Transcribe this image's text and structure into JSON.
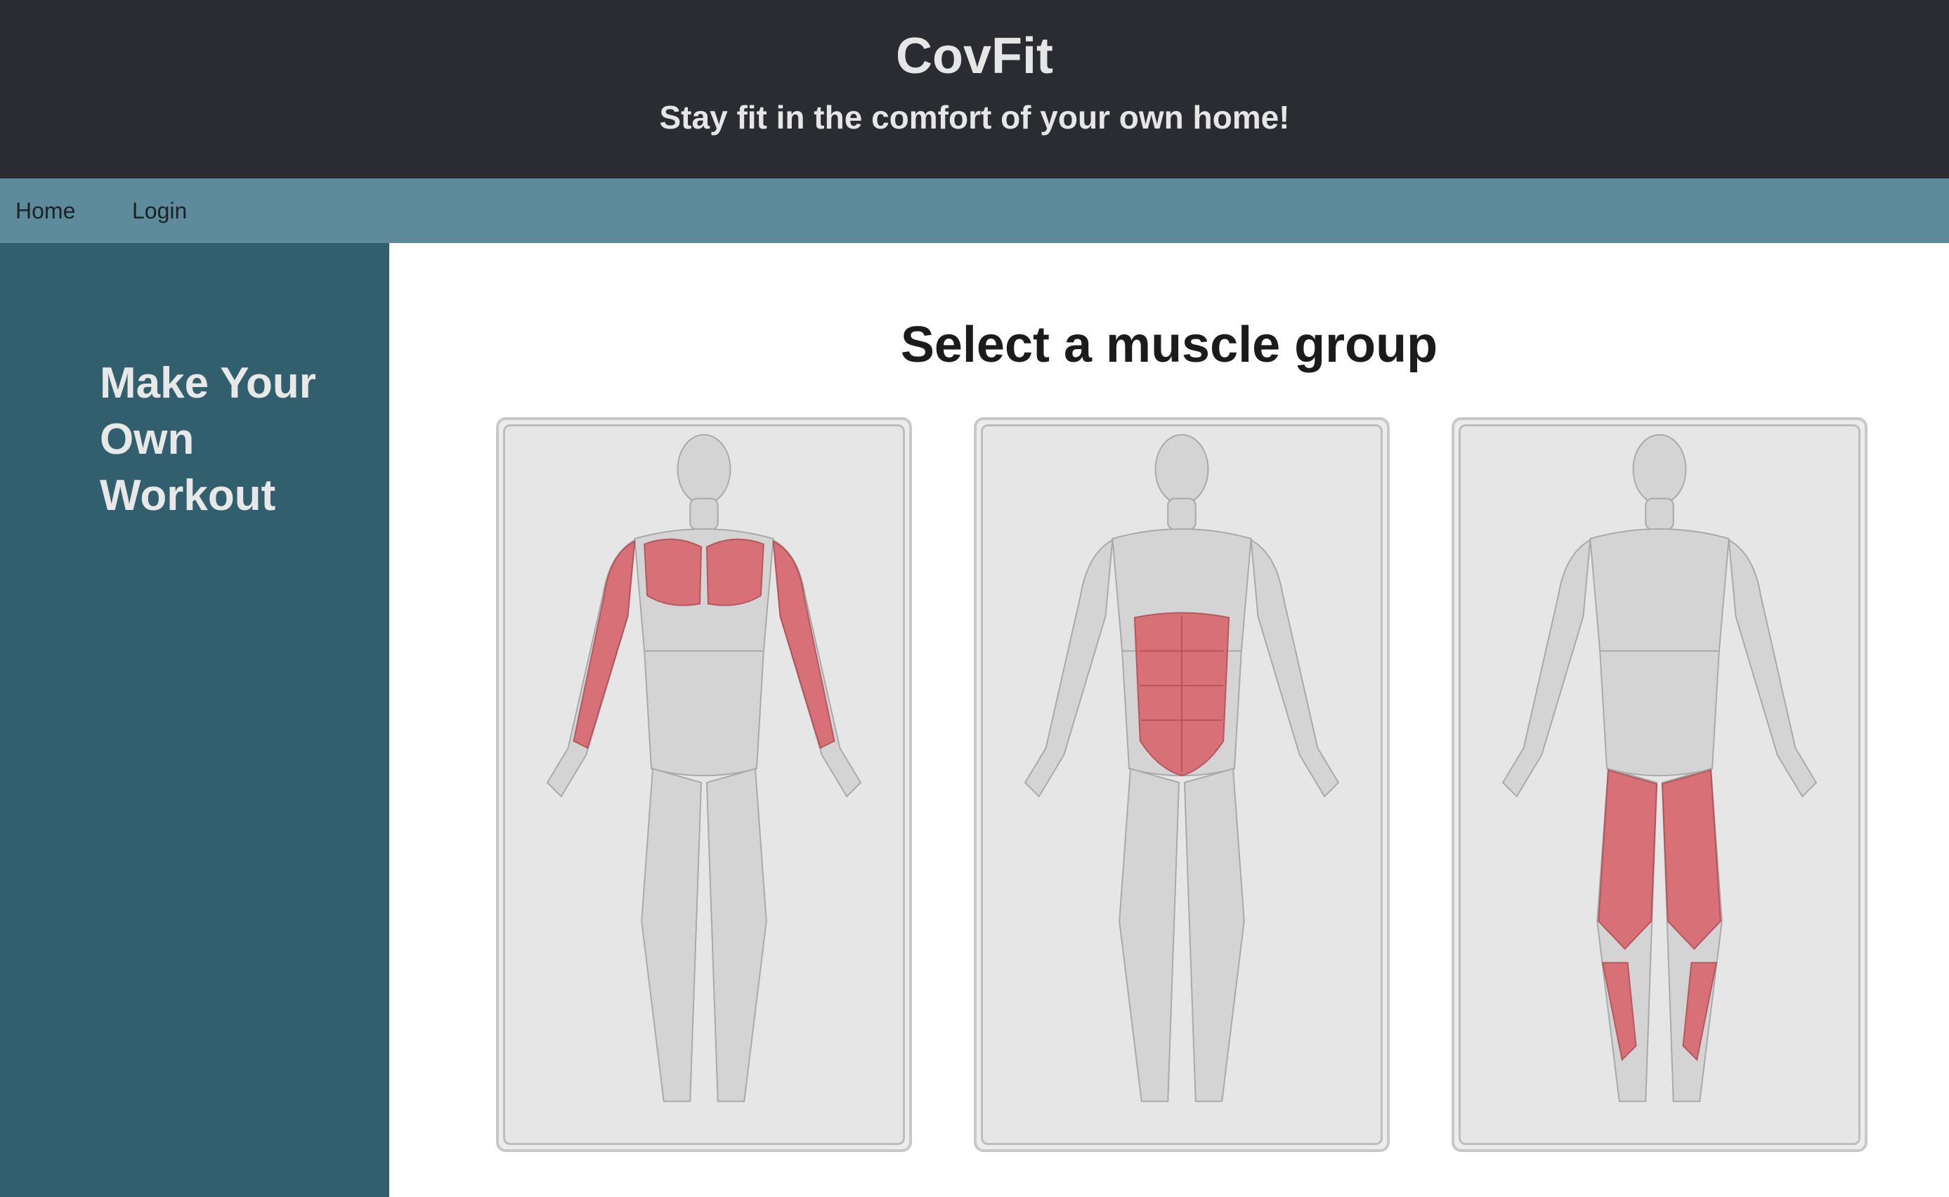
{
  "header": {
    "title": "CovFit",
    "tagline": "Stay fit in the comfort of your own home!"
  },
  "nav": {
    "items": [
      {
        "label": "Home"
      },
      {
        "label": "Login"
      }
    ]
  },
  "sidebar": {
    "heading": "Make Your Own Workout"
  },
  "main": {
    "title": "Select a muscle group",
    "cards": [
      {
        "highlight": "upper-body"
      },
      {
        "highlight": "abs"
      },
      {
        "highlight": "legs"
      }
    ]
  },
  "colors": {
    "header_bg": "#2b2c31",
    "nav_bg": "#5d8b9b",
    "sidebar_bg": "#325f6e",
    "card_bg": "#e6e6e6",
    "muscle_highlight": "#d9666d",
    "body_base": "#cfcfcf"
  }
}
